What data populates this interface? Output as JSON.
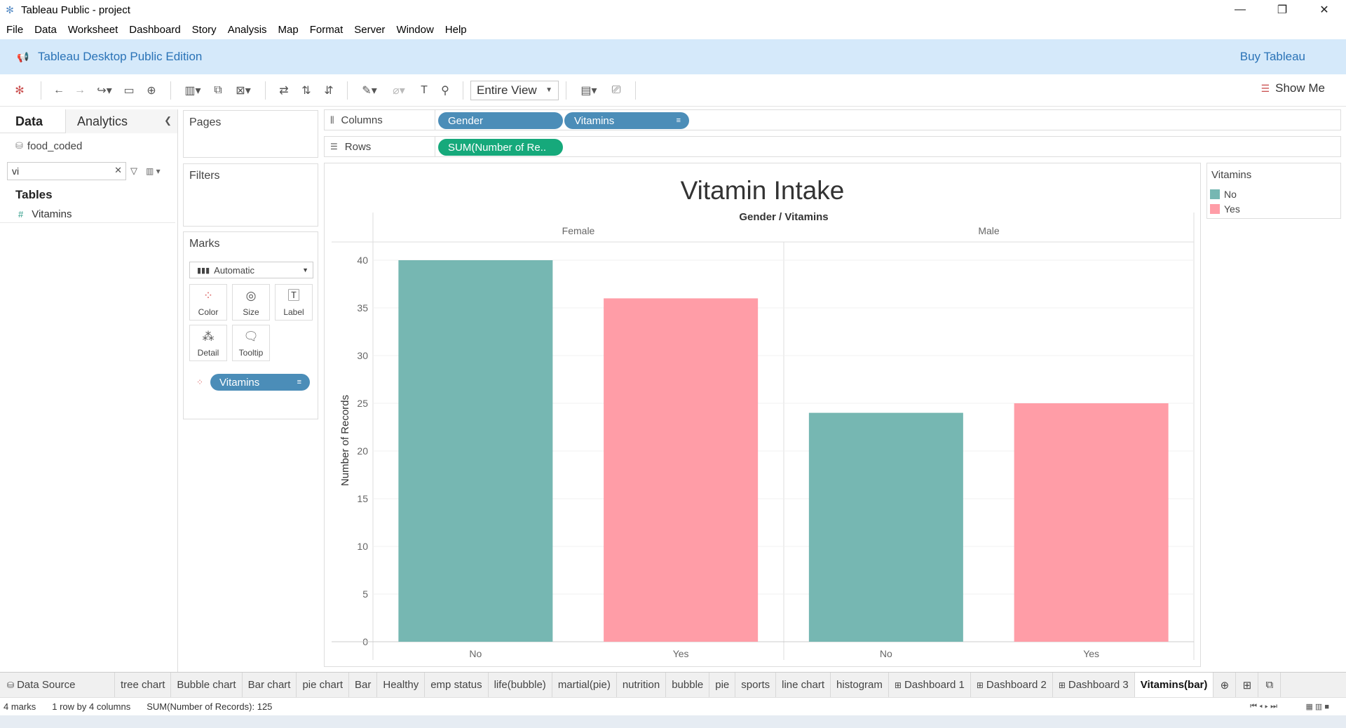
{
  "window": {
    "title": "Tableau Public - project",
    "minimize": "—",
    "restore": "❐",
    "close": "✕"
  },
  "menu": [
    "File",
    "Data",
    "Worksheet",
    "Dashboard",
    "Story",
    "Analysis",
    "Map",
    "Format",
    "Server",
    "Window",
    "Help"
  ],
  "banner": {
    "title": "Tableau Desktop Public Edition",
    "buy": "Buy Tableau"
  },
  "toolbar": {
    "fit": "Entire View",
    "show_me": "Show Me"
  },
  "left_pane": {
    "tab_data": "Data",
    "tab_analytics": "Analytics",
    "datasource": "food_coded",
    "search_value": "vi",
    "tables_heading": "Tables",
    "fields": [
      "Vitamins"
    ]
  },
  "cards": {
    "pages": "Pages",
    "filters": "Filters",
    "marks": "Marks",
    "mark_type": "Automatic",
    "buttons": {
      "color": "Color",
      "size": "Size",
      "label": "Label",
      "detail": "Detail",
      "tooltip": "Tooltip"
    },
    "color_pill": "Vitamins"
  },
  "shelves": {
    "columns_label": "Columns",
    "rows_label": "Rows",
    "columns": [
      "Gender",
      "Vitamins"
    ],
    "rows": [
      "SUM(Number of Re.."
    ]
  },
  "legend": {
    "title": "Vitamins",
    "items": [
      {
        "label": "No",
        "color": "#76b7b2"
      },
      {
        "label": "Yes",
        "color": "#ff9da7"
      }
    ]
  },
  "chart_data": {
    "type": "bar",
    "title": "Vitamin Intake",
    "header": "Gender / Vitamins",
    "panes": [
      "Female",
      "Male"
    ],
    "categories": [
      "No",
      "Yes",
      "No",
      "Yes"
    ],
    "values": [
      40,
      36,
      24,
      25
    ],
    "colors": [
      "#76b7b2",
      "#ff9da7",
      "#76b7b2",
      "#ff9da7"
    ],
    "ylabel": "Number of Records",
    "yticks": [
      0,
      5,
      10,
      15,
      20,
      25,
      30,
      35,
      40
    ],
    "ylim": [
      0,
      40
    ],
    "grid": true
  },
  "sheet_tabs": [
    "Data Source",
    "tree chart",
    "Bubble chart",
    "Bar chart",
    "pie chart",
    "Bar",
    "Healthy",
    "emp status",
    "life(bubble)",
    "martial(pie)",
    "nutrition",
    "bubble",
    "pie",
    "sports",
    "line chart",
    "histogram",
    "Dashboard 1",
    "Dashboard 2",
    "Dashboard 3",
    "Vitamins(bar)"
  ],
  "active_sheet": "Vitamins(bar)",
  "status": {
    "marks": "4 marks",
    "layout": "1 row by 4 columns",
    "sum": "SUM(Number of Records): 125"
  }
}
